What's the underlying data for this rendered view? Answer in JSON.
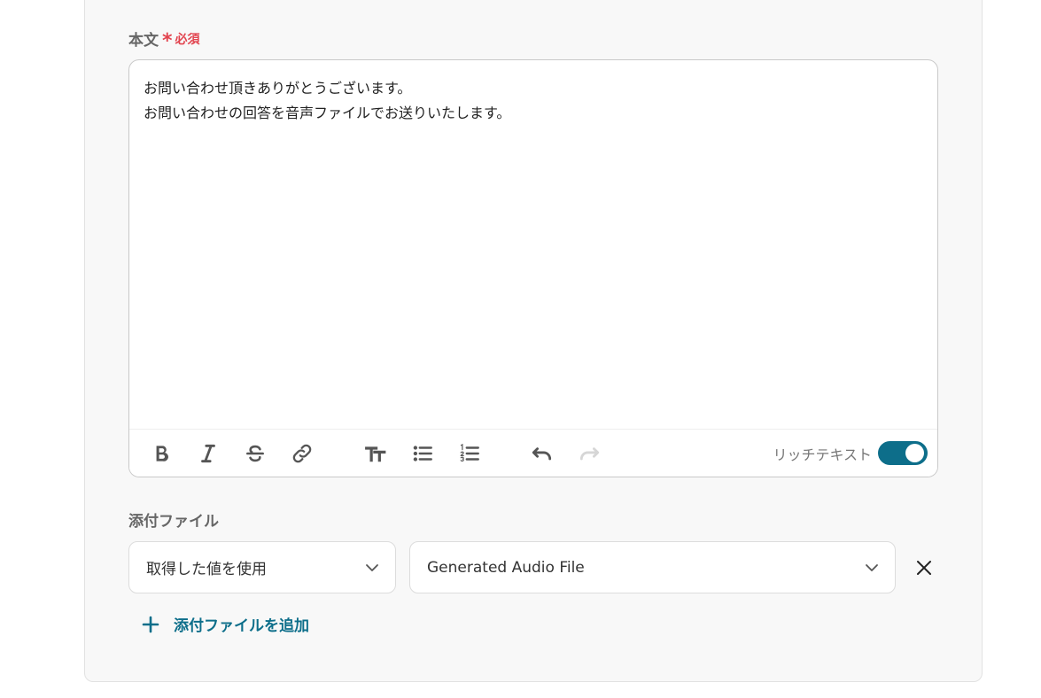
{
  "body_field": {
    "label": "本文",
    "required_mark": "*",
    "required_text": "必須",
    "lines": [
      "お問い合わせ頂きありがとうございます。",
      "お問い合わせの回答を音声ファイルでお送りいたします。"
    ]
  },
  "toolbar": {
    "buttons": [
      "bold-icon",
      "italic-icon",
      "strikethrough-icon",
      "link-icon",
      "text-size-icon",
      "bullet-list-icon",
      "numbered-list-icon",
      "undo-icon",
      "redo-icon"
    ],
    "rich_text_label": "リッチテキスト",
    "rich_text_enabled": true
  },
  "attachment": {
    "label": "添付ファイル",
    "source_select": "取得した値を使用",
    "value_select": "Generated Audio File",
    "add_label": "添付ファイルを追加"
  },
  "colors": {
    "accent": "#0d6e8a",
    "required": "#e2444f",
    "panel_bg": "#f8f8f8"
  }
}
